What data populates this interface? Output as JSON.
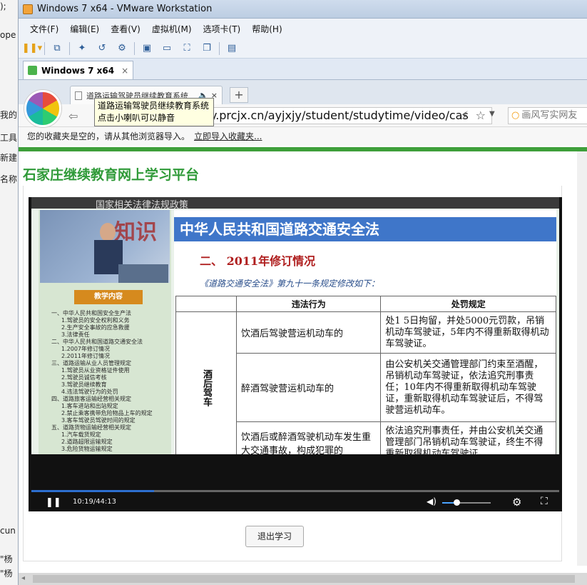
{
  "host_fragments": [
    ");",
    "ope",
    "我的",
    "工具",
    "新建",
    "名称",
    "cun",
    "\"杨",
    "\"杨"
  ],
  "vmware": {
    "title": "Windows 7 x64 - VMware Workstation",
    "menu": [
      "文件(F)",
      "编辑(E)",
      "查看(V)",
      "虚拟机(M)",
      "选项卡(T)",
      "帮助(H)"
    ],
    "tab_label": "Windows 7 x64",
    "tab_close": "×"
  },
  "browser": {
    "tab_title": "道路运输驾驶员继续教育系统",
    "tab_close": "×",
    "new_tab": "+",
    "url": "y.prcjx.cn/ayjxjy/student/studytime/video/cas",
    "search_placeholder": "画风写实网友",
    "tooltip_line1": "道路运输驾驶员继续教育系统",
    "tooltip_line2": "点击小喇叭可以静音",
    "favorites_text": "您的收藏夹是空的，请从其他浏览器导入。",
    "favorites_link": "立即导入收藏夹..."
  },
  "page": {
    "site_title": "石家庄继续教育网上学习平台",
    "exit_button": "退出学习"
  },
  "slide": {
    "top_band": "国家相关法律法规政策",
    "badge": "知识",
    "toc_title": "教学内容",
    "toc": [
      {
        "text": "一、中华人民共和国安全生产法",
        "sub": false
      },
      {
        "text": "1.驾驶员的安全权利和义务",
        "sub": true
      },
      {
        "text": "2.生产安全事故的应急救援",
        "sub": true
      },
      {
        "text": "3.法律责任",
        "sub": true
      },
      {
        "text": "二、中华人民共和国道路交通安全法",
        "sub": false
      },
      {
        "text": "1.2007年修订情况",
        "sub": true
      },
      {
        "text": "2.2011年修订情况",
        "sub": true
      },
      {
        "text": "三、道路运输从业人员管理规定",
        "sub": false
      },
      {
        "text": "1.驾驶员从业资格证件使用",
        "sub": true
      },
      {
        "text": "2.驾驶员诚信考核",
        "sub": true
      },
      {
        "text": "3.驾驶员继续教育",
        "sub": true
      },
      {
        "text": "4.违法驾驶行为的处罚",
        "sub": true
      },
      {
        "text": "四、道路旅客运输经营相关规定",
        "sub": false
      },
      {
        "text": "1.客车进站和出站规定",
        "sub": true
      },
      {
        "text": "2.禁止乘客携带危险物品上车的规定",
        "sub": true
      },
      {
        "text": "3.客车驾驶员驾驶时间的规定",
        "sub": true
      },
      {
        "text": "五、道路货物运输经营相关规定",
        "sub": false
      },
      {
        "text": "1.汽车载货规定",
        "sub": true
      },
      {
        "text": "2.道路超限运输规定",
        "sub": true
      },
      {
        "text": "3.危险货物运输规定",
        "sub": true
      }
    ],
    "heading": "中华人民共和国道路交通安全法",
    "subheading": "二、 2011年修订情况",
    "note": "《道路交通安全法》第九十一条规定修改如下：",
    "table": {
      "headers": [
        "违法行为",
        "处罚规定"
      ],
      "category": "酒后驾车",
      "rows": [
        {
          "act": "饮酒后驾驶营运机动车的",
          "penalty": "处1 5日拘留，并处5000元罚款，吊销机动车驾驶证，5年内不得重新取得机动车驾驶证。"
        },
        {
          "act": "醉酒驾驶营运机动车的",
          "penalty": "由公安机关交通管理部门约束至酒醒，吊销机动车驾驶证，依法追究刑事责任；10年内不得重新取得机动车驾驶证，重新取得机动车驾驶证后，不得驾驶营运机动车。"
        },
        {
          "act": "饮酒后或醉酒驾驶机动车发生重大交通事故，构成犯罪的",
          "penalty": "依法追究刑事责任，并由公安机关交通管理部门吊销机动车驾驶证，终生不得重新取得机动车驾驶证。"
        }
      ]
    }
  },
  "player": {
    "time": "10:19/44:13",
    "progress": 0.233,
    "volume": 0.3,
    "accent": "#2d6fcf"
  },
  "icons": [
    "pause-icon",
    "speaker-icon",
    "gear-icon",
    "fullscreen-icon",
    "star-icon",
    "back-arrow-icon",
    "search-icon",
    "close-icon"
  ]
}
